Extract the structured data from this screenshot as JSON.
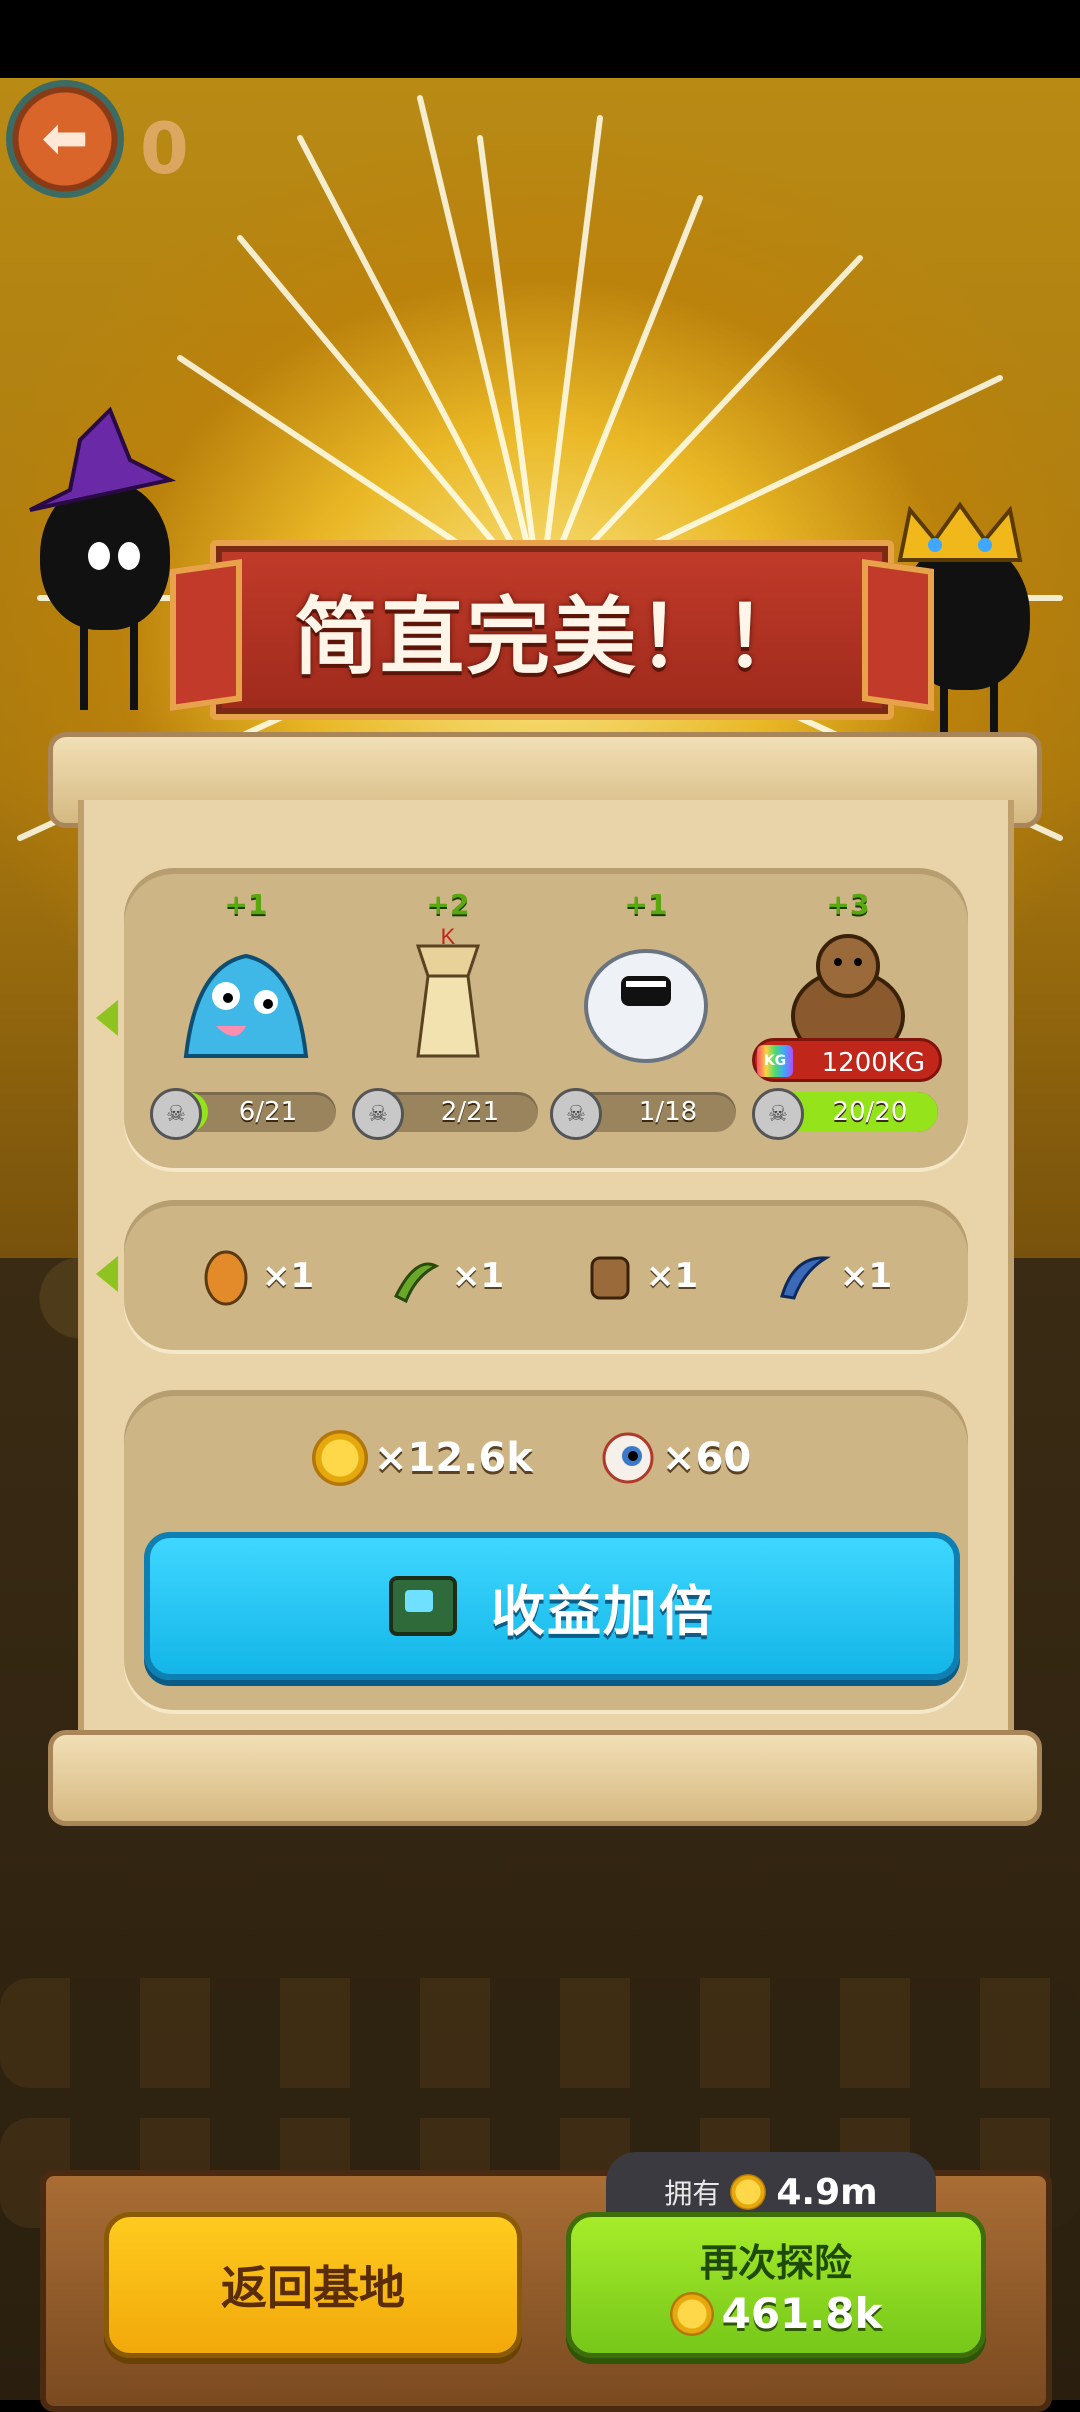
{
  "banner": {
    "title": "简直完美！！"
  },
  "top": {
    "counter": "0"
  },
  "creatures": [
    {
      "plus": "+1",
      "xp": "6/21",
      "xp_fraction": 0.29,
      "icon": "blue-slime-monster-icon"
    },
    {
      "plus": "+2",
      "xp": "2/21",
      "xp_fraction": 0.1,
      "icon": "straw-king-monster-icon"
    },
    {
      "plus": "+1",
      "xp": "1/18",
      "xp_fraction": 0.06,
      "icon": "white-yeti-monster-icon"
    },
    {
      "plus": "+3",
      "xp": "20/20",
      "xp_fraction": 1.0,
      "icon": "brown-bear-monster-icon",
      "weight": "1200KG",
      "weight_icon_label": "KG"
    }
  ],
  "items": [
    {
      "qty": "×1",
      "icon": "orange-egg-icon"
    },
    {
      "qty": "×1",
      "icon": "green-herb-icon"
    },
    {
      "qty": "×1",
      "icon": "brown-idol-icon"
    },
    {
      "qty": "×1",
      "icon": "blue-tentacle-icon"
    }
  ],
  "rewards": {
    "coins": "×12.6k",
    "eyes": "×60"
  },
  "double_button": {
    "label": "收益加倍"
  },
  "owned": {
    "label": "拥有",
    "value": "4.9m"
  },
  "return_button": {
    "label": "返回基地"
  },
  "retry_button": {
    "label": "再次探险",
    "cost": "461.8k"
  },
  "colors": {
    "accent_blue": "#13b6e8",
    "accent_green": "#76c71a",
    "accent_yellow": "#f2a90a",
    "banner_red": "#c23b2a"
  }
}
